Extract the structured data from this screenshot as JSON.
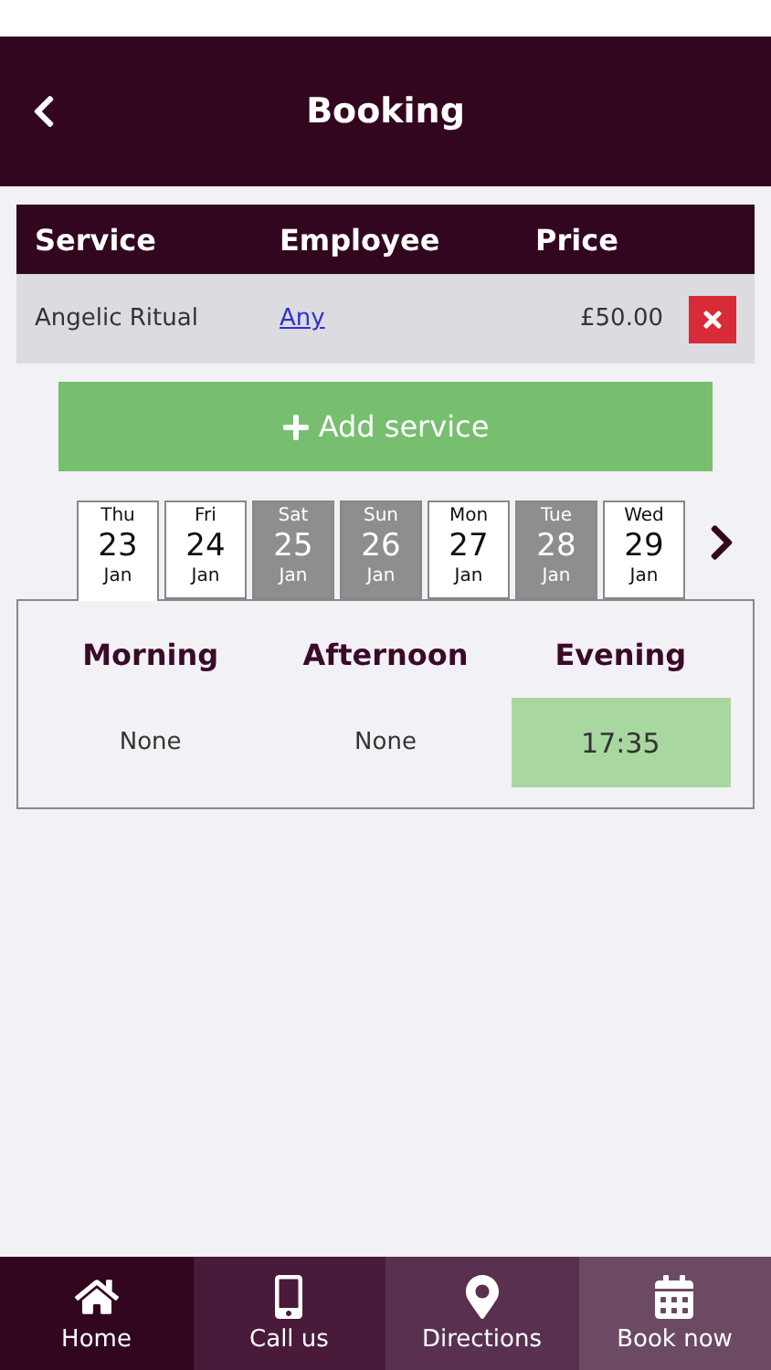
{
  "header": {
    "title": "Booking"
  },
  "table": {
    "columns": [
      "Service",
      "Employee",
      "Price"
    ],
    "rows": [
      {
        "service": "Angelic Ritual",
        "employee": "Any",
        "price": "£50.00"
      }
    ]
  },
  "add_button": {
    "label": "Add service"
  },
  "days": [
    {
      "weekday": "Thu",
      "day": "23",
      "month": "Jan",
      "selected": true,
      "disabled": false
    },
    {
      "weekday": "Fri",
      "day": "24",
      "month": "Jan",
      "selected": false,
      "disabled": false
    },
    {
      "weekday": "Sat",
      "day": "25",
      "month": "Jan",
      "selected": false,
      "disabled": true
    },
    {
      "weekday": "Sun",
      "day": "26",
      "month": "Jan",
      "selected": false,
      "disabled": true
    },
    {
      "weekday": "Mon",
      "day": "27",
      "month": "Jan",
      "selected": false,
      "disabled": false
    },
    {
      "weekday": "Tue",
      "day": "28",
      "month": "Jan",
      "selected": false,
      "disabled": true
    },
    {
      "weekday": "Wed",
      "day": "29",
      "month": "Jan",
      "selected": false,
      "disabled": false
    }
  ],
  "periods": [
    {
      "name": "Morning",
      "slot": "None",
      "available": false
    },
    {
      "name": "Afternoon",
      "slot": "None",
      "available": false
    },
    {
      "name": "Evening",
      "slot": "17:35",
      "available": true
    }
  ],
  "nav": [
    {
      "kind": "home",
      "label": "Home"
    },
    {
      "kind": "phone",
      "label": "Call us"
    },
    {
      "kind": "pin",
      "label": "Directions"
    },
    {
      "kind": "calendar",
      "label": "Book now"
    }
  ]
}
